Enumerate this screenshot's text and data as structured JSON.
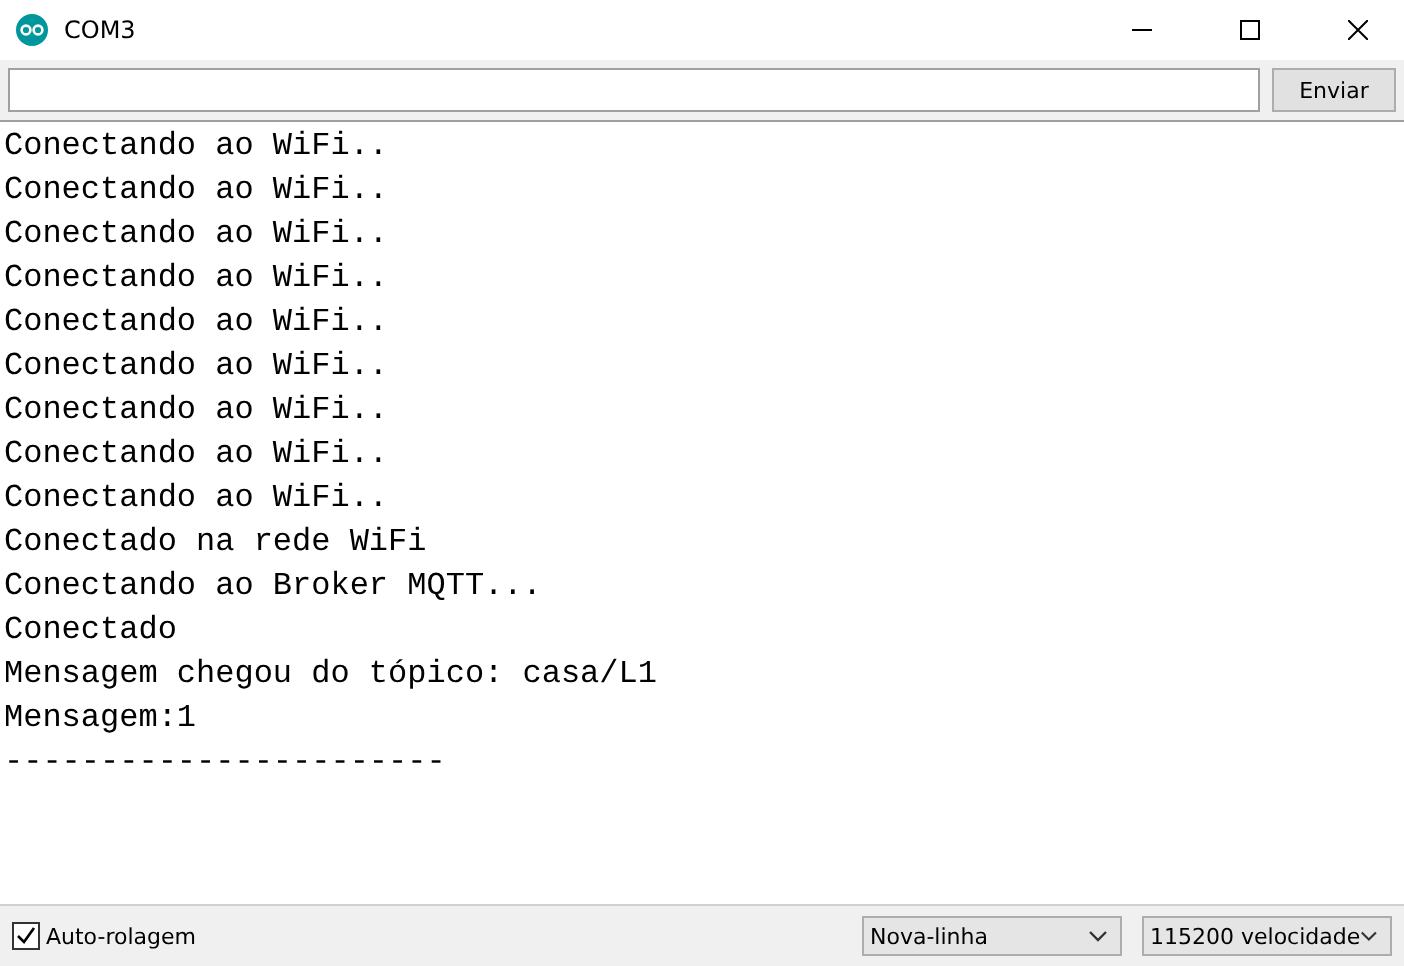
{
  "window": {
    "title": "COM3"
  },
  "send_button": "Enviar",
  "output_lines": [
    "Conectando ao WiFi..",
    "Conectando ao WiFi..",
    "Conectando ao WiFi..",
    "Conectando ao WiFi..",
    "Conectando ao WiFi..",
    "Conectando ao WiFi..",
    "Conectando ao WiFi..",
    "Conectando ao WiFi..",
    "Conectando ao WiFi..",
    "Conectado na rede WiFi",
    "Conectando ao Broker MQTT...",
    "Conectado",
    "Mensagem chegou do tópico: casa/L1",
    "Mensagem:1",
    "-----------------------"
  ],
  "status_bar": {
    "autoscroll": {
      "label": "Auto-rolagem",
      "checked": true
    },
    "line_ending": "Nova-linha",
    "baud_rate": "115200 velocidade"
  }
}
